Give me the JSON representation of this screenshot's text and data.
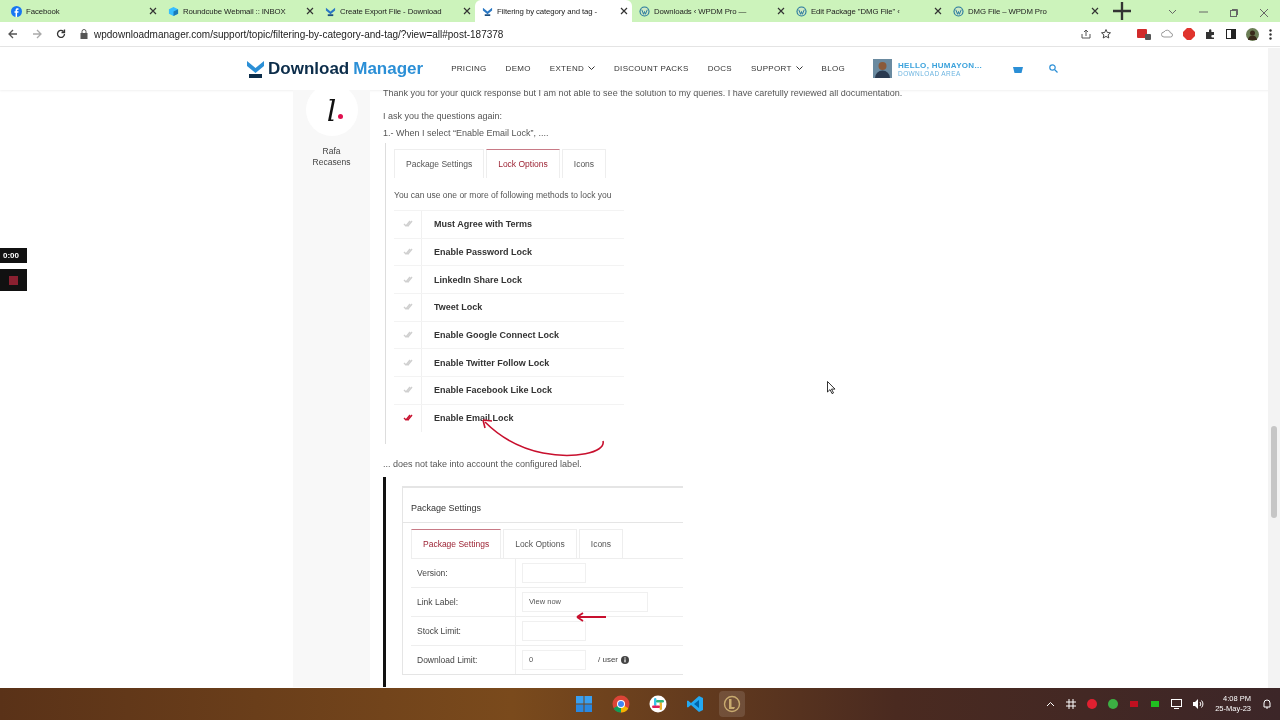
{
  "browser": {
    "tabs": [
      {
        "title": "Facebook",
        "kind": "facebook",
        "selected": false
      },
      {
        "title": "Roundcube Webmail :: INBOX",
        "kind": "roundcube",
        "selected": false
      },
      {
        "title": "Create Export File - Download",
        "kind": "wpdm",
        "selected": false
      },
      {
        "title": "Filtering by category and tag -",
        "kind": "wpdm",
        "selected": true
      },
      {
        "title": "Downloads ‹ WPDM Pro —",
        "kind": "wordpress",
        "selected": false
      },
      {
        "title": "Edit Package \"DMG File\" ‹",
        "kind": "wordpress",
        "selected": false
      },
      {
        "title": "DMG File – WPDM Pro",
        "kind": "wordpress",
        "selected": false
      }
    ],
    "url": "wpdownloadmanager.com/support/topic/filtering-by-category-and-tag/?view=all#post-187378"
  },
  "site_header": {
    "logo": {
      "first": "Download",
      "second": "Manager"
    },
    "nav": [
      {
        "label": "PRICING",
        "dropdown": false
      },
      {
        "label": "DEMO",
        "dropdown": false
      },
      {
        "label": "EXTEND",
        "dropdown": true
      },
      {
        "label": "DISCOUNT PACKS",
        "dropdown": false
      },
      {
        "label": "DOCS",
        "dropdown": false
      },
      {
        "label": "SUPPORT",
        "dropdown": true
      },
      {
        "label": "BLOG",
        "dropdown": false
      }
    ],
    "user": {
      "greeting": "HELLO, HUMAYON...",
      "subtitle": "DOWNLOAD AREA"
    }
  },
  "recorder": {
    "time": "0:00"
  },
  "post": {
    "author": {
      "avatar_letter": "l",
      "name": "Rafa Recasens"
    },
    "paragraphs": [
      "Thank you for your quick response but I am not able to see the solution to my queries. I have carefully reviewed all documentation.",
      "I ask you the questions again:",
      "1.- When I select “Enable Email Lock”, ...."
    ],
    "screenshot_1": {
      "tabs": [
        {
          "label": "Package Settings",
          "selected": false
        },
        {
          "label": "Lock Options",
          "selected": true
        },
        {
          "label": "Icons",
          "selected": false
        }
      ],
      "description": "You can use one or more of following methods to lock you",
      "locks": [
        {
          "label": "Must Agree with Terms",
          "checked": false
        },
        {
          "label": "Enable Password Lock",
          "checked": false
        },
        {
          "label": "LinkedIn Share Lock",
          "checked": false
        },
        {
          "label": "Tweet Lock",
          "checked": false
        },
        {
          "label": "Enable Google Connect Lock",
          "checked": false
        },
        {
          "label": "Enable Twitter Follow Lock",
          "checked": false
        },
        {
          "label": "Enable Facebook Like Lock",
          "checked": false
        },
        {
          "label": "Enable Email Lock",
          "checked": true
        }
      ]
    },
    "after_text": "... does not take into account the configured label.",
    "screenshot_2": {
      "title": "Package Settings",
      "tabs": [
        {
          "label": "Package Settings",
          "selected": true
        },
        {
          "label": "Lock Options",
          "selected": false
        },
        {
          "label": "Icons",
          "selected": false
        }
      ],
      "fields": [
        {
          "label": "Version:"
        },
        {
          "label": "Link Label:",
          "value": "View now"
        },
        {
          "label": "Stock Limit:"
        },
        {
          "label": "Download Limit:",
          "value": "0",
          "suffix": "/ user"
        }
      ]
    }
  },
  "taskbar": {
    "apps": [
      {
        "kind": "start",
        "selected": false
      },
      {
        "kind": "chrome",
        "selected": false
      },
      {
        "kind": "slack",
        "selected": false
      },
      {
        "kind": "vscode",
        "selected": false
      },
      {
        "kind": "league",
        "selected": true
      }
    ],
    "time": "4:08 PM",
    "date": "25-May-23"
  }
}
